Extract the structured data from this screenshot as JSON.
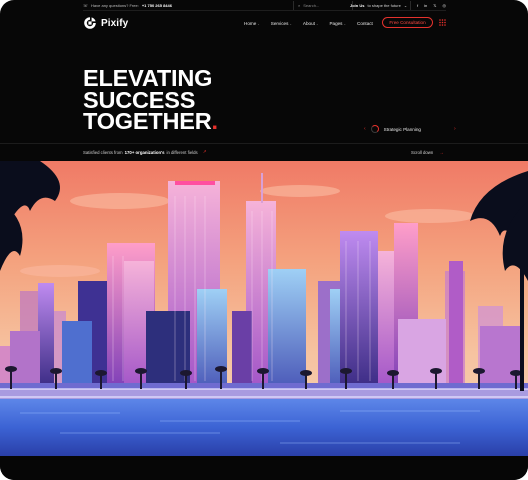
{
  "topbar": {
    "question_label": "Have any questions? Free:",
    "phone": "+1 750 265 8446",
    "search_placeholder": "Search...",
    "promo_bold": "Join Us",
    "promo_text": "to shape the future",
    "promo_caret": "⌄",
    "socials": [
      {
        "icon": "facebook-icon",
        "glyph": "f"
      },
      {
        "icon": "linkedin-icon",
        "glyph": "in"
      },
      {
        "icon": "x-twitter-icon",
        "glyph": "𝕏"
      },
      {
        "icon": "instagram-icon",
        "glyph": "◎"
      }
    ]
  },
  "brand": {
    "name": "Pixify"
  },
  "nav": {
    "items": [
      {
        "label": "Home",
        "has_dropdown": true
      },
      {
        "label": "Services",
        "has_dropdown": true
      },
      {
        "label": "About",
        "has_dropdown": true
      },
      {
        "label": "Pages",
        "has_dropdown": true
      },
      {
        "label": "Contact",
        "has_dropdown": false
      }
    ],
    "cta_label": "Free Consultation"
  },
  "hero": {
    "headline_lines": [
      "ELEVATING",
      "SUCCESS",
      "TOGETHER"
    ],
    "headline_dot": ".",
    "slider_label": "Strategic Planning",
    "prev_arrow": "‹",
    "next_arrow": "›",
    "subline_prefix": "Satisfied clients from",
    "subline_bold": "170+ organization's",
    "subline_suffix": "in different fields",
    "subline_arrow": "↗",
    "scroll_label": "Scroll down",
    "scroll_arrow": "→"
  },
  "colors": {
    "accent": "#e8312b",
    "background": "#070707",
    "text": "#ffffff"
  }
}
